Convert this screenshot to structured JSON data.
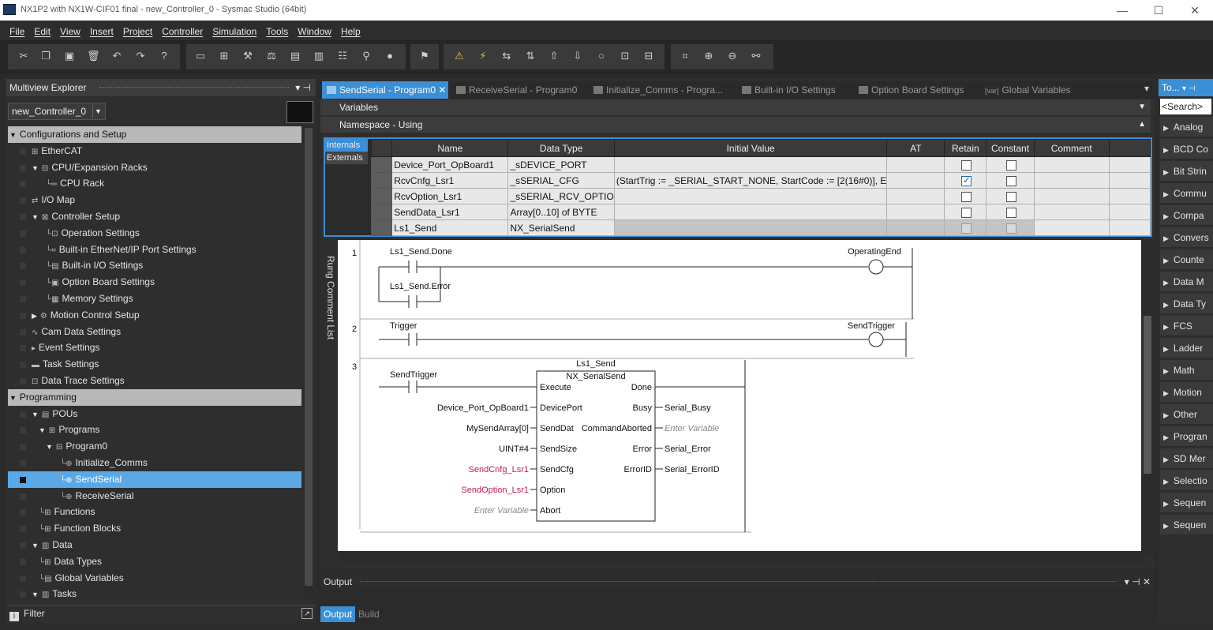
{
  "window": {
    "title": "NX1P2 with NX1W-CIF01 final - new_Controller_0 - Sysmac Studio (64bit)",
    "min": "—",
    "max": "☐",
    "close": "✕"
  },
  "menu": [
    "File",
    "Edit",
    "View",
    "Insert",
    "Project",
    "Controller",
    "Simulation",
    "Tools",
    "Window",
    "Help"
  ],
  "explorer": {
    "title": "Multiview Explorer",
    "pin": "▾ ⊣",
    "controller": "new_Controller_0",
    "filter": "Filter",
    "tree": [
      {
        "label": "Configurations and Setup",
        "type": "section",
        "arrow": "▼"
      },
      {
        "label": "EtherCAT",
        "indent": 2,
        "icon": "⊞"
      },
      {
        "label": "CPU/Expansion Racks",
        "indent": 2,
        "arrow": "▼",
        "icon": "⊟"
      },
      {
        "label": "CPU Rack",
        "indent": 4,
        "icon": "└═"
      },
      {
        "label": "I/O Map",
        "indent": 2,
        "icon": "⇄"
      },
      {
        "label": "Controller Setup",
        "indent": 2,
        "arrow": "▼",
        "icon": "⊠"
      },
      {
        "label": "Operation Settings",
        "indent": 4,
        "icon": "└⊡"
      },
      {
        "label": "Built-in EtherNet/IP Port Settings",
        "indent": 4,
        "icon": "└⌗"
      },
      {
        "label": "Built-in I/O Settings",
        "indent": 4,
        "icon": "└▤"
      },
      {
        "label": "Option Board Settings",
        "indent": 4,
        "icon": "└▣"
      },
      {
        "label": "Memory Settings",
        "indent": 4,
        "icon": "└▦"
      },
      {
        "label": "Motion Control Setup",
        "indent": 2,
        "arrow": "▶",
        "icon": "⚙"
      },
      {
        "label": "Cam Data Settings",
        "indent": 2,
        "icon": "∿"
      },
      {
        "label": "Event Settings",
        "indent": 2,
        "icon": "▸"
      },
      {
        "label": "Task Settings",
        "indent": 2,
        "icon": "▬"
      },
      {
        "label": "Data Trace Settings",
        "indent": 2,
        "icon": "⊡"
      },
      {
        "label": "Programming",
        "type": "section",
        "arrow": "▼"
      },
      {
        "label": "POUs",
        "indent": 2,
        "arrow": "▼",
        "icon": "▤"
      },
      {
        "label": "Programs",
        "indent": 3,
        "arrow": "▼",
        "icon": "⊞"
      },
      {
        "label": "Program0",
        "indent": 4,
        "arrow": "▼",
        "icon": "⊟"
      },
      {
        "label": "Initialize_Comms",
        "indent": 6,
        "icon": "└⊕"
      },
      {
        "label": "SendSerial",
        "indent": 6,
        "icon": "└⊕",
        "selected": true
      },
      {
        "label": "ReceiveSerial",
        "indent": 6,
        "icon": "└⊕"
      },
      {
        "label": "Functions",
        "indent": 3,
        "icon": "└⊞"
      },
      {
        "label": "Function Blocks",
        "indent": 3,
        "icon": "└⊞"
      },
      {
        "label": "Data",
        "indent": 2,
        "arrow": "▼",
        "icon": "▥"
      },
      {
        "label": "Data Types",
        "indent": 3,
        "icon": "└⊞"
      },
      {
        "label": "Global Variables",
        "indent": 3,
        "icon": "└▤"
      },
      {
        "label": "Tasks",
        "indent": 2,
        "arrow": "▼",
        "icon": "▥"
      }
    ]
  },
  "tabs": [
    {
      "label": "SendSerial - Program0",
      "active": true,
      "close": "✕"
    },
    {
      "label": "ReceiveSerial - Program0"
    },
    {
      "label": "Initialize_Comms - Progra..."
    },
    {
      "label": "Built-in I/O Settings"
    },
    {
      "label": "Option Board Settings"
    },
    {
      "label": "Global Variables",
      "prefix": "[var]"
    }
  ],
  "sections": {
    "variables": "Variables",
    "namespace": "Namespace - Using",
    "collapse": "▼",
    "expand": "▲"
  },
  "vartabs": [
    "Internals",
    "Externals"
  ],
  "columns": [
    "Name",
    "Data Type",
    "Initial Value",
    "AT",
    "Retain",
    "Constant",
    "Comment"
  ],
  "vars": [
    {
      "name": "Device_Port_OpBoard1",
      "type": "_sDEVICE_PORT",
      "init": "",
      "retain": false,
      "constant": false
    },
    {
      "name": "RcvCnfg_Lsr1",
      "type": "_sSERIAL_CFG",
      "init": "(StartTrig := _SERIAL_START_NONE, StartCode := [2(16#0)], E",
      "retain": true,
      "constant": false
    },
    {
      "name": "RcvOption_Lsr1",
      "type": "_sSERIAL_RCV_OPTIO",
      "init": "",
      "retain": false,
      "constant": false
    },
    {
      "name": "SendData_Lsr1",
      "type": "Array[0..10] of BYTE",
      "init": "",
      "retain": false,
      "constant": false
    },
    {
      "name": "Ls1_Send",
      "type": "NX_SerialSend",
      "init": "",
      "retain": false,
      "constant": false,
      "disabled": true
    }
  ],
  "rung_comment_list": "Rung Comment List",
  "ladder": {
    "rung1": {
      "num": "1",
      "contact1": "Ls1_Send.Done",
      "contact2": "Ls1_Send.Error",
      "coil": "OperatingEnd"
    },
    "rung2": {
      "num": "2",
      "contact": "Trigger",
      "coil": "SendTrigger"
    },
    "rung3": {
      "num": "3",
      "contact": "SendTrigger",
      "instance": "Ls1_Send",
      "fb": "NX_SerialSend",
      "inputs": [
        "Execute",
        "DevicePort",
        "SendDat",
        "SendSize",
        "SendCfg",
        "Option",
        "Abort"
      ],
      "outputs": [
        "Done",
        "Busy",
        "CommandAborted",
        "Error",
        "ErrorID"
      ],
      "in_vars": [
        "",
        "Device_Port_OpBoard1",
        "MySendArray[0]",
        "UINT#4",
        "SendCnfg_Lsr1",
        "SendOption_Lsr1",
        "Enter Variable"
      ],
      "out_vars": [
        "",
        "Serial_Busy",
        "Enter Variable",
        "Serial_Error",
        "Serial_ErrorID"
      ]
    }
  },
  "output": {
    "title": "Output",
    "tabs": [
      "Output",
      "Build"
    ],
    "controls": "▾ ⊣ ✕"
  },
  "toolbox": {
    "title": "To...",
    "pin": "▾ ⊣",
    "search": "<Search>",
    "items": [
      "Analog",
      "BCD Co",
      "Bit Strin",
      "Commu",
      "Compa",
      "Convers",
      "Counte",
      "Data M",
      "Data Ty",
      "FCS",
      "Ladder",
      "Math",
      "Motion",
      "Other",
      "Progran",
      "SD Mer",
      "Selectio",
      "Sequen",
      "Sequen"
    ]
  },
  "colors": {
    "accent": "#3b8fd6",
    "selected": "#5aa9e6",
    "magenta": "#c2185b",
    "placeholder": "#888888"
  }
}
